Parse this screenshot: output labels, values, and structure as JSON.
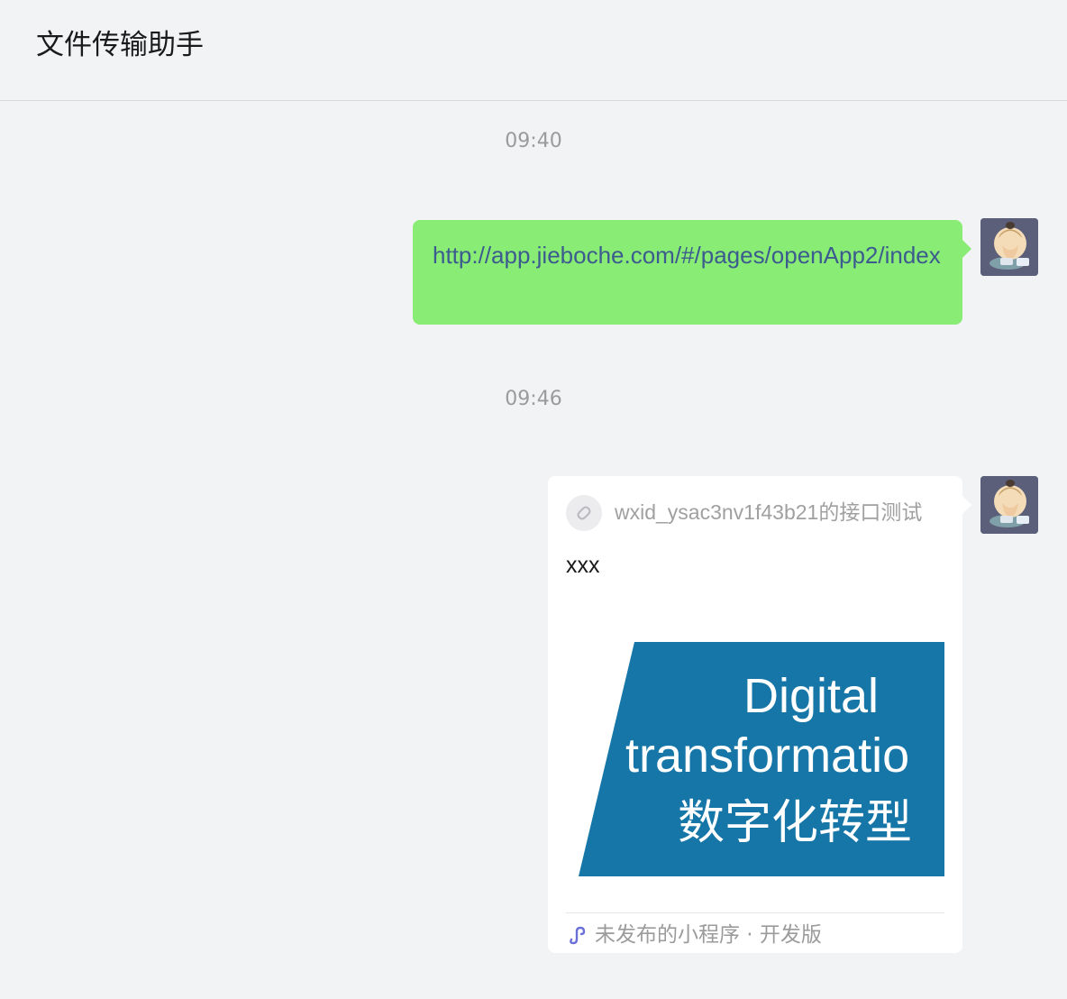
{
  "header": {
    "title": "文件传输助手"
  },
  "messages": [
    {
      "timestamp": "09:40",
      "type": "link",
      "text": "http://app.jieboche.com/#/pages/openApp2/index",
      "bubble_color": "#89ec75",
      "link_color": "#3c5b8e"
    },
    {
      "timestamp": "09:46",
      "type": "mini-program-card",
      "source": "wxid_ysac3nv1f43b21的接口测试",
      "title": "xxx",
      "image": {
        "line1": "Digital",
        "line2": "transformatio",
        "line3": "数字化转型",
        "bg_color": "#1576a7"
      },
      "footer": "未发布的小程序 · 开发版",
      "footer_icon_color": "#6b6fd8"
    }
  ],
  "icons": {
    "avatar": "cartoon-person-avatar-icon",
    "source": "mini-program-link-icon",
    "footer": "mini-program-icon"
  }
}
